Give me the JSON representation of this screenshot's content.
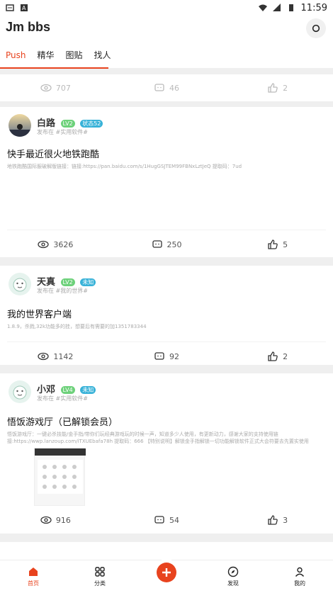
{
  "status_bar": {
    "time": "11:59"
  },
  "header": {
    "title": "Jm bbs",
    "tabs": [
      {
        "label": "Push",
        "active": true
      },
      {
        "label": "精华"
      },
      {
        "label": "图贴"
      },
      {
        "label": "找人"
      }
    ]
  },
  "posts": [
    {
      "views": "707",
      "comments": "46",
      "likes": "2"
    },
    {
      "username": "白路",
      "level": "LV2",
      "tag": "状态52",
      "posted_in": "发布在 #实用软件#",
      "title": "快手最近很火地铁跑酷",
      "body": "地铁跑酷国际服破解版链接：链接:https://pan.baidu.com/s/1HugGSJTEM99FBNxLztJeQ 提取码：7ud",
      "views": "3626",
      "comments": "250",
      "likes": "5"
    },
    {
      "username": "天真",
      "level": "LV2",
      "tag": "未知",
      "posted_in": "发布在 #我的世界#",
      "title": "我的世界客户端",
      "body": "1.8.9，杀戮,32k功能多的挂，想要后有需要的加1351783344",
      "views": "1142",
      "comments": "92",
      "likes": "2"
    },
    {
      "username": "小邓",
      "level": "LV4",
      "tag": "未知",
      "posted_in": "发布在 #实用软件#",
      "title": "悟饭游戏厅（已解锁会员）",
      "body": "悟饭游戏厅：一键必杀技能/金手指/带你们玩经典游戏玩的时候一声，知道多少人使用，有更新动力，感谢大家的支持使用链接:https://wwp.lanzoup.com/iTXUEbafa78h 提取码：666 【特别说明】解锁金手指解锁一切功能解锁软件正式大会符要去先置实使用",
      "views": "916",
      "comments": "54",
      "likes": "3"
    }
  ],
  "bottom_nav": {
    "home": "首页",
    "category": "分类",
    "discover": "发现",
    "mine": "我的"
  },
  "colors": {
    "accent": "#e8431e",
    "level_badge": "#6dd17a",
    "tag_badge": "#38b2d8"
  }
}
